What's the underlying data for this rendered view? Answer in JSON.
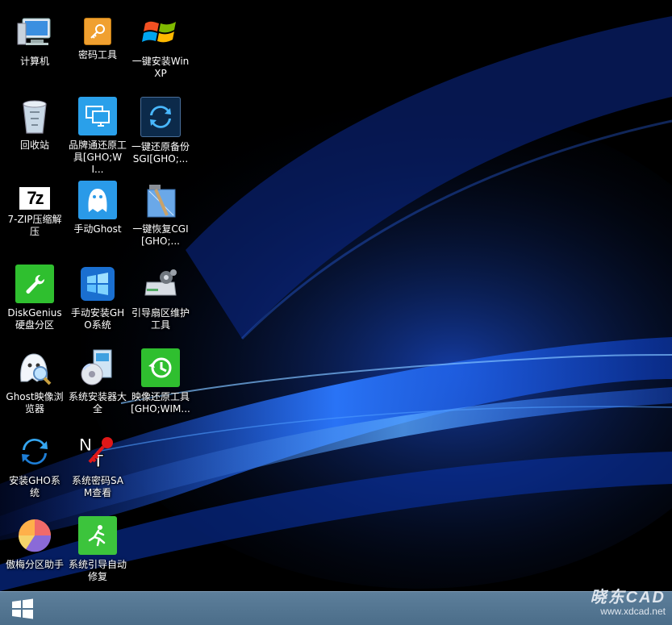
{
  "desktop": {
    "icons": [
      {
        "label": "计算机",
        "icon": "computer-icon"
      },
      {
        "label": "密码工具",
        "icon": "key-icon"
      },
      {
        "label": "一键安装WinXP",
        "icon": "windows-xp-icon"
      },
      {
        "label": "回收站",
        "icon": "recycle-bin-icon"
      },
      {
        "label": "品牌通还原工具[GHO;WI...",
        "icon": "monitor-icon"
      },
      {
        "label": "一键还原备份SGI[GHO;...",
        "icon": "refresh-icon"
      },
      {
        "label": "7-ZIP压缩解压",
        "icon": "7zip-icon"
      },
      {
        "label": "手动Ghost",
        "icon": "ghost-icon"
      },
      {
        "label": "一键恢复CGI[GHO;...",
        "icon": "hammer-icon"
      },
      {
        "label": "DiskGenius硬盘分区",
        "icon": "wrench-icon"
      },
      {
        "label": "手动安装GHO系统",
        "icon": "windows-orb-icon"
      },
      {
        "label": "引导扇区维护工具",
        "icon": "hard-drive-gear-icon"
      },
      {
        "label": "Ghost映像浏览器",
        "icon": "ghost-magnifier-icon"
      },
      {
        "label": "系统安装器大全",
        "icon": "installer-disc-icon"
      },
      {
        "label": "映像还原工具[GHO;WIM...",
        "icon": "restore-clock-icon"
      },
      {
        "label": "安装GHO系统",
        "icon": "sync-arrows-icon"
      },
      {
        "label": "系统密码SAM查看",
        "icon": "nt-key-icon"
      },
      {
        "label": "傲梅分区助手",
        "icon": "pie-chart-icon"
      },
      {
        "label": "系统引导自动修复",
        "icon": "running-man-icon"
      }
    ]
  },
  "taskbar": {
    "start_icon": "windows-logo-icon"
  },
  "watermark": {
    "title": "晓东CAD",
    "url": "www.xdcad.net"
  },
  "colors": {
    "desktop_bg": "#000000",
    "wave_blue": "#1e6cff",
    "taskbar": "#557892"
  }
}
